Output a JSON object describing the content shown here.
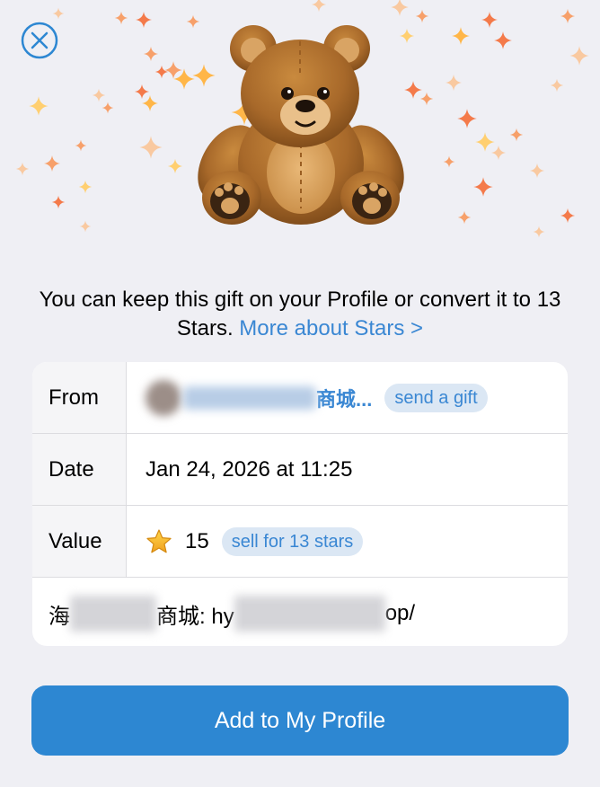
{
  "header": {
    "close_icon": "close-circle-icon",
    "gift_icon": "teddy-bear-icon"
  },
  "description": {
    "text": "You can keep this gift on your Profile or convert it to 13 Stars.",
    "link": "More about Stars >"
  },
  "details": {
    "from": {
      "label": "From",
      "name_suffix": "商城...",
      "action": "send a gift"
    },
    "date": {
      "label": "Date",
      "value": "Jan 24, 2026 at 11:25"
    },
    "value": {
      "label": "Value",
      "star_icon": "star-icon",
      "amount": "15",
      "action": "sell for 13 stars"
    },
    "note": {
      "prefix": "海",
      "middle": "商城: hy",
      "suffix": "op/"
    }
  },
  "primary_button": {
    "label": "Add to My Profile"
  },
  "colors": {
    "accent": "#2d87d2",
    "link": "#3a87d3",
    "pill_bg": "#dbe7f4",
    "background": "#efeff4"
  }
}
